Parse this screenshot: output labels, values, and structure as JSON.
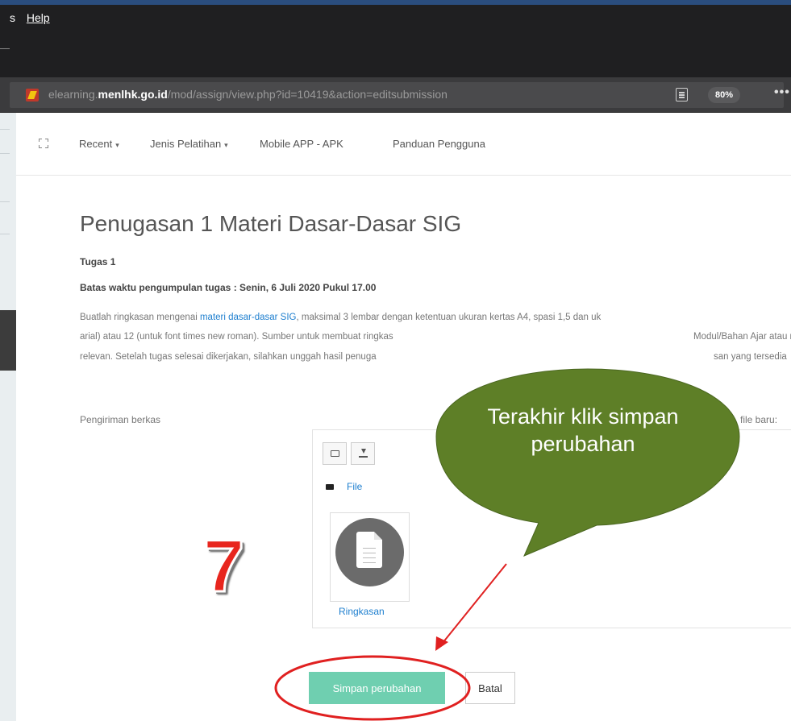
{
  "menu": {
    "left_fragment": "s",
    "help_label": "Help"
  },
  "browser": {
    "url_domain_prefix": "elearning.",
    "url_domain_bold": "menlhk.go.id",
    "url_path": "/mod/assign/view.php?id=10419&action=editsubmission",
    "zoom": "80%",
    "more_label": "•••"
  },
  "nav": {
    "items": [
      {
        "label": "Recent",
        "has_caret": true
      },
      {
        "label": "Jenis Pelatihan",
        "has_caret": true
      },
      {
        "label": "Mobile APP - APK",
        "has_caret": false
      },
      {
        "label": "Panduan Pengguna",
        "has_caret": false
      }
    ]
  },
  "assignment": {
    "title": "Penugasan 1 Materi Dasar-Dasar SIG",
    "subtitle": "Tugas 1",
    "deadline": "Batas waktu pengumpulan tugas : Senin, 6 Juli 2020 Pukul 17.00",
    "para_line1_before": "Buatlah ringkasan mengenai ",
    "para_line1_link": "materi dasar-dasar SIG",
    "para_line1_after": ", maksimal 3 lembar dengan ketentuan ukuran kertas A4,  spasi 1,5 dan uk",
    "para_line2_left": "arial) atau 12 (untuk font times new roman). Sumber untuk membuat ringkas",
    "para_line2_right": "Modul/Bahan Ajar atau m",
    "para_line3_left": "relevan. Setelah tugas selesai dikerjakan, silahkan unggah hasil penuga",
    "para_line3_right": "san yang tersedia"
  },
  "submission": {
    "label": "Pengiriman berkas",
    "new_file_label": "file baru:",
    "folder_label": "File",
    "file_name": "Ringkasan"
  },
  "actions": {
    "save_label": "Simpan perubahan",
    "cancel_label": "Batal"
  },
  "annotation": {
    "bubble_text": "Terakhir klik simpan perubahan",
    "step_number": "7",
    "bubble_color": "#5e7f27",
    "arrow_color": "#e02020",
    "number_color": "#e8261e"
  }
}
